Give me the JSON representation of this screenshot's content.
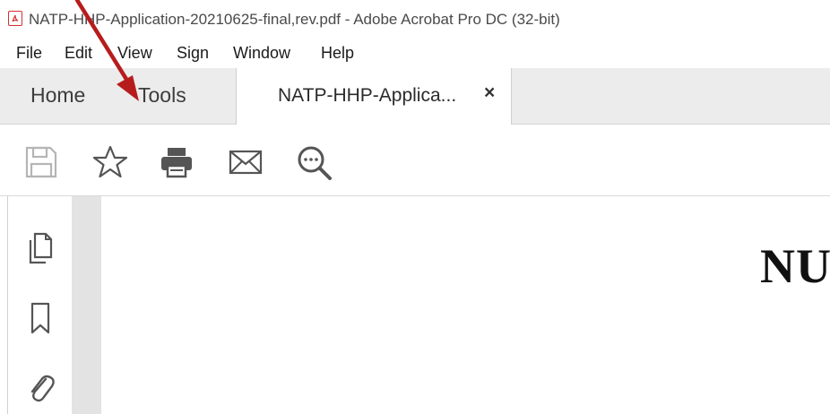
{
  "window": {
    "title": "NATP-HHP-Application-20210625-final,rev.pdf - Adobe Acrobat Pro DC (32-bit)"
  },
  "menu": {
    "items": [
      "File",
      "Edit",
      "View",
      "Sign",
      "Window",
      "Help"
    ]
  },
  "tabs": {
    "home": "Home",
    "tools": "Tools",
    "document": "NATP-HHP-Applica...",
    "close": "×"
  },
  "toolbar": {
    "icons": [
      "save-icon",
      "bookmark-star-icon",
      "print-icon",
      "email-icon",
      "search-zoom-icon"
    ]
  },
  "sidebar": {
    "icons": [
      "page-thumbnails-icon",
      "bookmarks-icon",
      "attachments-icon"
    ]
  },
  "document": {
    "visible_text": "NU"
  },
  "colors": {
    "accent_red": "#b71c1c",
    "tab_bar_bg": "#ececec",
    "gutter_bg": "#e3e3e3"
  }
}
